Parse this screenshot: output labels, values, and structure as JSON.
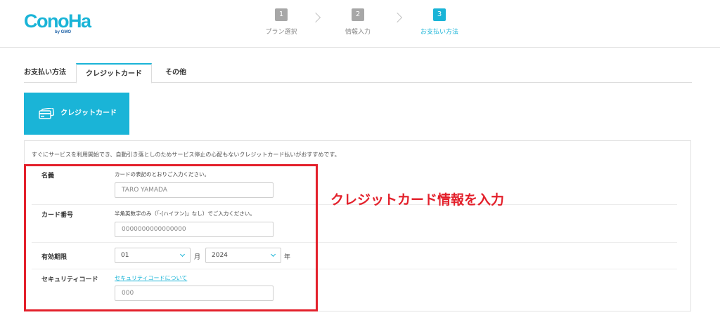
{
  "brand": {
    "logo_text": "ConoHa",
    "logo_sub": "by GMO",
    "logo_color": "#1ab4d7"
  },
  "steps": [
    {
      "num": "1",
      "label": "プラン選択"
    },
    {
      "num": "2",
      "label": "情報入力"
    },
    {
      "num": "3",
      "label": "お支払い方法"
    }
  ],
  "tabs": {
    "heading": "お支払い方法",
    "credit": "クレジットカード",
    "other": "その他"
  },
  "method_tile": {
    "label": "クレジットカード",
    "icon": "credit-card-icon"
  },
  "form": {
    "intro": "すぐにサービスを利用開始でき、自動引き落としのためサービス停止の心配もないクレジットカード払いがおすすめです。",
    "name": {
      "label": "名義",
      "hint": "カードの表記のとおりご入力ください。",
      "placeholder": "TARO YAMADA"
    },
    "card_number": {
      "label": "カード番号",
      "hint": "半角英数字のみ（「-(ハイフン)」なし）でご入力ください。",
      "placeholder": "0000000000000000"
    },
    "expiry": {
      "label": "有効期限",
      "month": "01",
      "month_unit": "月",
      "year": "2024",
      "year_unit": "年"
    },
    "security": {
      "label": "セキュリティコード",
      "link": "セキュリティコードについて",
      "placeholder": "000"
    }
  },
  "annotation": {
    "text": "クレジットカード情報を入力",
    "color": "#e3202b"
  }
}
